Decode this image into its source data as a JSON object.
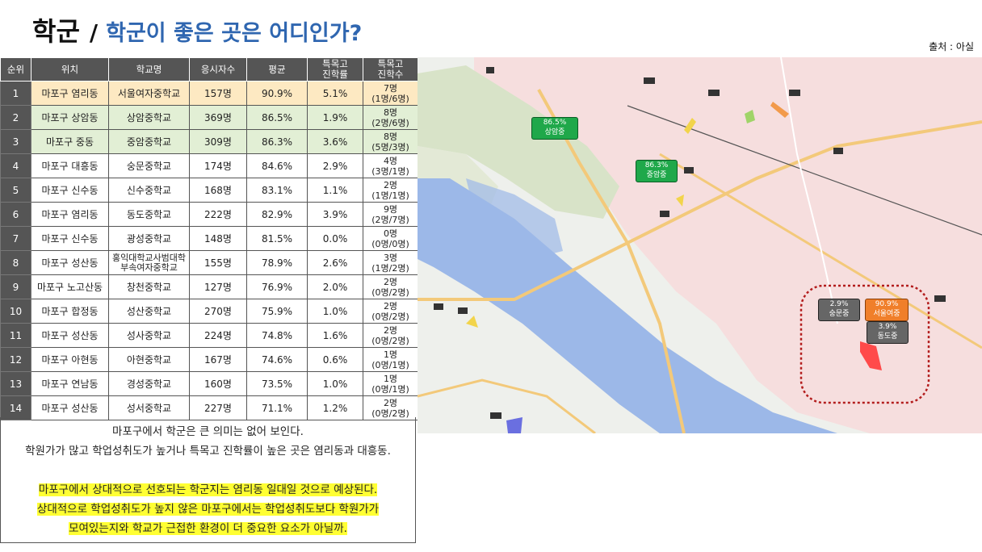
{
  "title": {
    "main": "학군",
    "sep": "/",
    "sub": "학군이 좋은 곳은 어디인가?"
  },
  "source": "출처 : 아실",
  "table": {
    "headers": [
      "순위",
      "위치",
      "학교명",
      "응시자수",
      "평균",
      "특목고\n진학률",
      "특목고\n진학수"
    ],
    "rows": [
      {
        "rank": "1",
        "loc": "마포구 염리동",
        "school": "서울여자중학교",
        "takers": "157명",
        "avg": "90.9%",
        "rate": "5.1%",
        "count": "7명\n(1명/6명)"
      },
      {
        "rank": "2",
        "loc": "마포구 상암동",
        "school": "상암중학교",
        "takers": "369명",
        "avg": "86.5%",
        "rate": "1.9%",
        "count": "8명\n(2명/6명)"
      },
      {
        "rank": "3",
        "loc": "마포구 중동",
        "school": "중암중학교",
        "takers": "309명",
        "avg": "86.3%",
        "rate": "3.6%",
        "count": "8명\n(5명/3명)"
      },
      {
        "rank": "4",
        "loc": "마포구 대흥동",
        "school": "숭문중학교",
        "takers": "174명",
        "avg": "84.6%",
        "rate": "2.9%",
        "count": "4명\n(3명/1명)"
      },
      {
        "rank": "5",
        "loc": "마포구 신수동",
        "school": "신수중학교",
        "takers": "168명",
        "avg": "83.1%",
        "rate": "1.1%",
        "count": "2명\n(1명/1명)"
      },
      {
        "rank": "6",
        "loc": "마포구 염리동",
        "school": "동도중학교",
        "takers": "222명",
        "avg": "82.9%",
        "rate": "3.9%",
        "count": "9명\n(2명/7명)"
      },
      {
        "rank": "7",
        "loc": "마포구 신수동",
        "school": "광성중학교",
        "takers": "148명",
        "avg": "81.5%",
        "rate": "0.0%",
        "count": "0명\n(0명/0명)"
      },
      {
        "rank": "8",
        "loc": "마포구 성산동",
        "school": "홍익대학교사범대학\n부속여자중학교",
        "takers": "155명",
        "avg": "78.9%",
        "rate": "2.6%",
        "count": "3명\n(1명/2명)"
      },
      {
        "rank": "9",
        "loc": "마포구 노고산동",
        "school": "창천중학교",
        "takers": "127명",
        "avg": "76.9%",
        "rate": "2.0%",
        "count": "2명\n(0명/2명)"
      },
      {
        "rank": "10",
        "loc": "마포구 합정동",
        "school": "성산중학교",
        "takers": "270명",
        "avg": "75.9%",
        "rate": "1.0%",
        "count": "2명\n(0명/2명)"
      },
      {
        "rank": "11",
        "loc": "마포구 성산동",
        "school": "성사중학교",
        "takers": "224명",
        "avg": "74.8%",
        "rate": "1.6%",
        "count": "2명\n(0명/2명)"
      },
      {
        "rank": "12",
        "loc": "마포구 아현동",
        "school": "아현중학교",
        "takers": "167명",
        "avg": "74.6%",
        "rate": "0.6%",
        "count": "1명\n(0명/1명)"
      },
      {
        "rank": "13",
        "loc": "마포구 연남동",
        "school": "경성중학교",
        "takers": "160명",
        "avg": "73.5%",
        "rate": "1.0%",
        "count": "1명\n(0명/1명)"
      },
      {
        "rank": "14",
        "loc": "마포구 성산동",
        "school": "성서중학교",
        "takers": "227명",
        "avg": "71.1%",
        "rate": "1.2%",
        "count": "2명\n(0명/2명)"
      }
    ]
  },
  "summary": {
    "line1": "마포구에서 학군은 큰 의미는 없어 보인다.",
    "line2": "학원가가 많고 학업성취도가 높거나 특목고 진학률이 높은 곳은 염리동과 대흥동.",
    "hl1": "마포구에서 상대적으로 선호되는 학군지는 염리동 일대일 것으로 예상된다.",
    "hl2": "상대적으로 학업성취도가 높지 않은 마포구에서는 학업성취도보다 학원가가",
    "hl3": "모여있는지와 학교가 근접한 환경이 더 중요한 요소가 아닐까."
  },
  "map": {
    "labels": [
      {
        "id": "sangam",
        "pct": "86.5%",
        "name": "상암중",
        "color": "#1fa84a"
      },
      {
        "id": "jungam",
        "pct": "86.3%",
        "name": "중암중",
        "color": "#1fa84a"
      },
      {
        "id": "sungmun",
        "pct": "2.9%",
        "name": "숭문중",
        "color": "#666666"
      },
      {
        "id": "seoulyeo",
        "pct": "90.9%",
        "name": "서울여중",
        "color": "#f07f2a"
      },
      {
        "id": "dongdo",
        "pct": "3.9%",
        "name": "동도중",
        "color": "#666666"
      }
    ],
    "colors": {
      "river": "#9cb8e8",
      "district": "#f6dede",
      "park": "#d8e3c8",
      "road": "#f3c97a",
      "highlight_circle": "#b31d1d"
    }
  }
}
